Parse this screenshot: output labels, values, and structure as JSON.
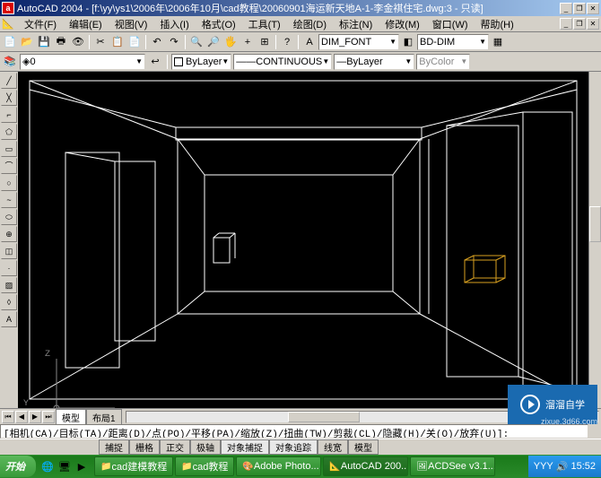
{
  "titlebar": {
    "icon_letter": "a",
    "app": "AutoCAD 2004",
    "path": "[f:\\yy\\ys1\\2006年\\2006年10月\\cad教程\\20060901海运新天地A-1-李金祺住宅.dwg:3 - 只读]",
    "min": "_",
    "max": "❐",
    "close": "✕"
  },
  "menu": {
    "items": [
      "文件(F)",
      "编辑(E)",
      "视图(V)",
      "插入(I)",
      "格式(O)",
      "工具(T)",
      "绘图(D)",
      "标注(N)",
      "修改(M)",
      "窗口(W)",
      "帮助(H)"
    ]
  },
  "tb1_icons": [
    "📄",
    "📂",
    "💾",
    "🖶",
    "👁",
    "✂",
    "📋",
    "📄",
    "↶",
    "↷",
    "🔍",
    "🔎",
    "🖐",
    "+",
    "⊞",
    "?",
    "A",
    "◧",
    "▦"
  ],
  "tb1_style": {
    "label": "DIM_FONT"
  },
  "tb1_dim": {
    "label": "BD-DIM"
  },
  "props": {
    "layer_state": "◈",
    "layer": "0",
    "linetype": "CONTINUOUS",
    "lineweight": "ByLayer",
    "color": "ByLayer",
    "plotstyle": "ByColor"
  },
  "ucs": {
    "z": "Z",
    "y": "Y"
  },
  "tabs": {
    "nav": [
      "⏮",
      "◀",
      "▶",
      "⏭"
    ],
    "items": [
      "模型",
      "布局1"
    ]
  },
  "cmd": {
    "line": "[相机(CA)/目标(TA)/距离(D)/点(PO)/平移(PA)/缩放(Z)/扭曲(TW)/剪裁(CL)/隐藏(H)/关(O)/放弃(U)]:"
  },
  "status": {
    "items": [
      "捕捉",
      "栅格",
      "正交",
      "极轴",
      "对象捕捉",
      "对象追踪",
      "线宽",
      "模型"
    ]
  },
  "taskbar": {
    "start": "开始",
    "tasks": [
      "cad建模教程",
      "cad教程",
      "Adobe Photo...",
      "AutoCAD 200...",
      "ACDSee v3.1..."
    ],
    "tray_text": "YYY",
    "time": "15:52"
  },
  "watermark": {
    "text": "溜溜自学",
    "url": "zixue.3d66.com"
  }
}
